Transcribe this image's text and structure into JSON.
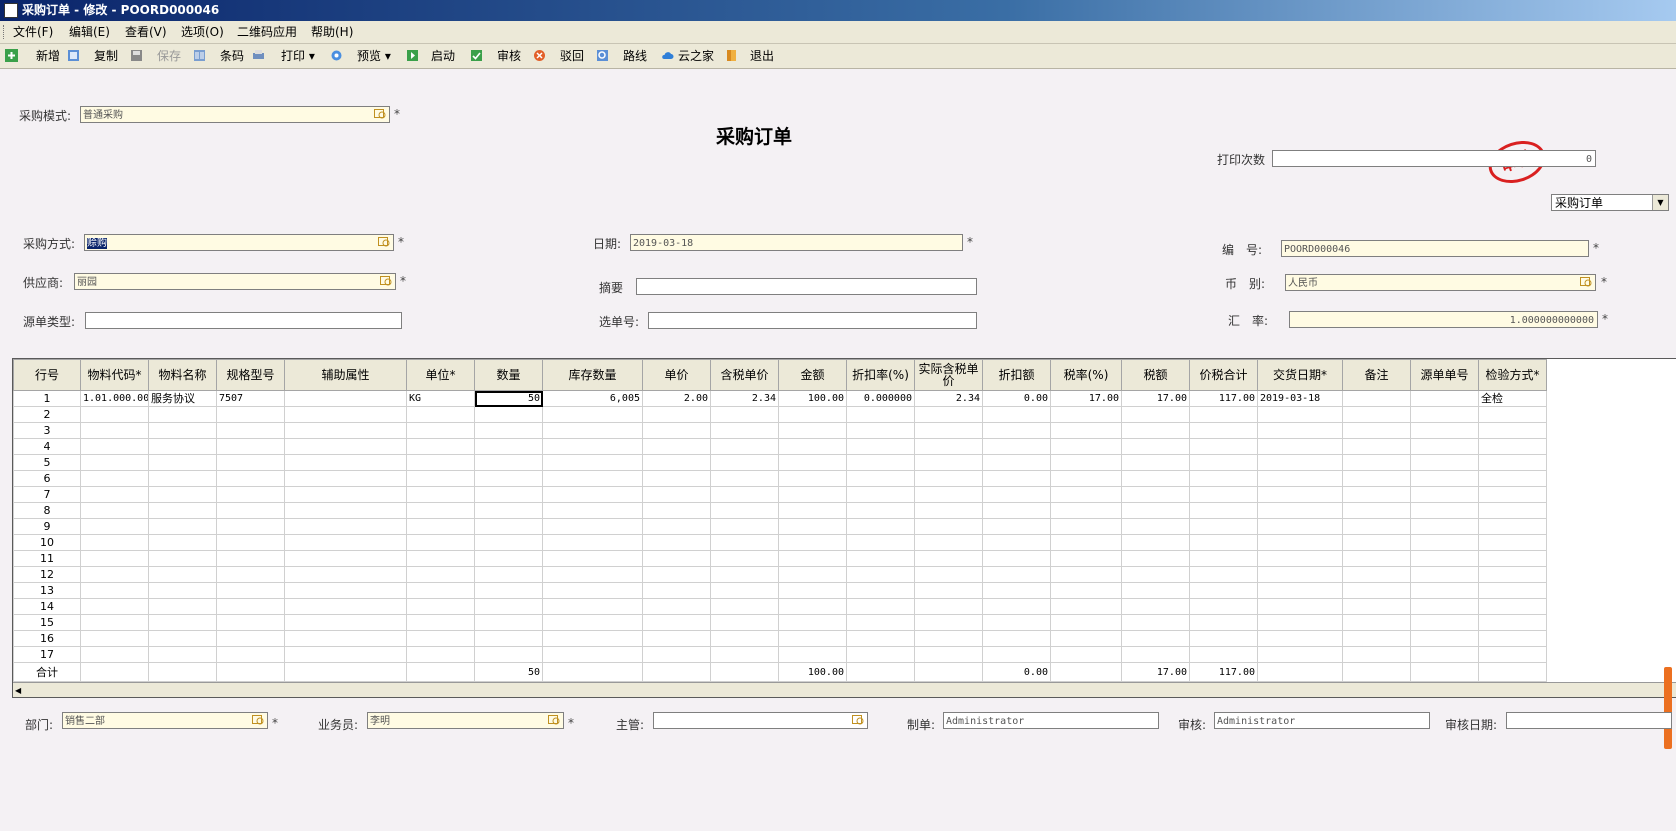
{
  "window": {
    "title": "采购订单 - 修改 - POORD000046"
  },
  "menu": [
    "文件(F)",
    "编辑(E)",
    "查看(V)",
    "选项(O)",
    "二维码应用",
    "帮助(H)"
  ],
  "toolbar": {
    "new": "新增",
    "copy": "复制",
    "save": "保存",
    "barcode": "条码",
    "print": "打印",
    "preview": "预览",
    "start": "启动",
    "audit": "审核",
    "reject": "驳回",
    "route": "路线",
    "cloud": "云之家",
    "exit": "退出"
  },
  "doc": {
    "title": "采购订单",
    "stamp": "审核",
    "type_select": "采购订单"
  },
  "header": {
    "purchase_mode_label": "采购模式:",
    "purchase_mode": "普通采购",
    "print_count_label": "打印次数",
    "print_count": "0",
    "purchase_method_label": "采购方式:",
    "purchase_method": "赊购",
    "date_label": "日期:",
    "date": "2019-03-18",
    "number_label": "编　号:",
    "number": "POORD000046",
    "supplier_label": "供应商:",
    "supplier": "丽园",
    "summary_label": "摘要",
    "summary": "",
    "currency_label": "币　别:",
    "currency": "人民币",
    "source_type_label": "源单类型:",
    "source_type": "",
    "select_no_label": "选单号:",
    "select_no": "",
    "rate_label": "汇　率:",
    "rate": "1.000000000000"
  },
  "table": {
    "columns": [
      "行号",
      "物料代码*",
      "物料名称",
      "规格型号",
      "辅助属性",
      "单位*",
      "数量",
      "库存数量",
      "单价",
      "含税单价",
      "金额",
      "折扣率(%)",
      "实际含税单价",
      "折扣额",
      "税率(%)",
      "税额",
      "价税合计",
      "交货日期*",
      "备注",
      "源单单号",
      "检验方式*"
    ],
    "rows": [
      [
        "1",
        "1.01.000.00",
        "服务协议",
        "7507",
        "",
        "KG",
        "50",
        "6,005",
        "2.00",
        "2.34",
        "100.00",
        "0.000000",
        "2.34",
        "0.00",
        "17.00",
        "17.00",
        "117.00",
        "2019-03-18",
        "",
        "",
        "全检"
      ]
    ],
    "row_numbers": [
      "2",
      "3",
      "4",
      "5",
      "6",
      "7",
      "8",
      "9",
      "10",
      "11",
      "12",
      "13",
      "14",
      "15",
      "16",
      "17"
    ],
    "total": {
      "label": "合计",
      "qty": "50",
      "amount": "100.00",
      "discount": "0.00",
      "tax": "17.00",
      "total": "117.00"
    }
  },
  "footer": {
    "dept_label": "部门:",
    "dept": "销售二部",
    "salesman_label": "业务员:",
    "salesman": "李明",
    "manager_label": "主管:",
    "manager": "",
    "maker_label": "制单:",
    "maker": "Administrator",
    "auditor_label": "审核:",
    "auditor": "Administrator",
    "audit_date_label": "审核日期:",
    "audit_date": ""
  }
}
